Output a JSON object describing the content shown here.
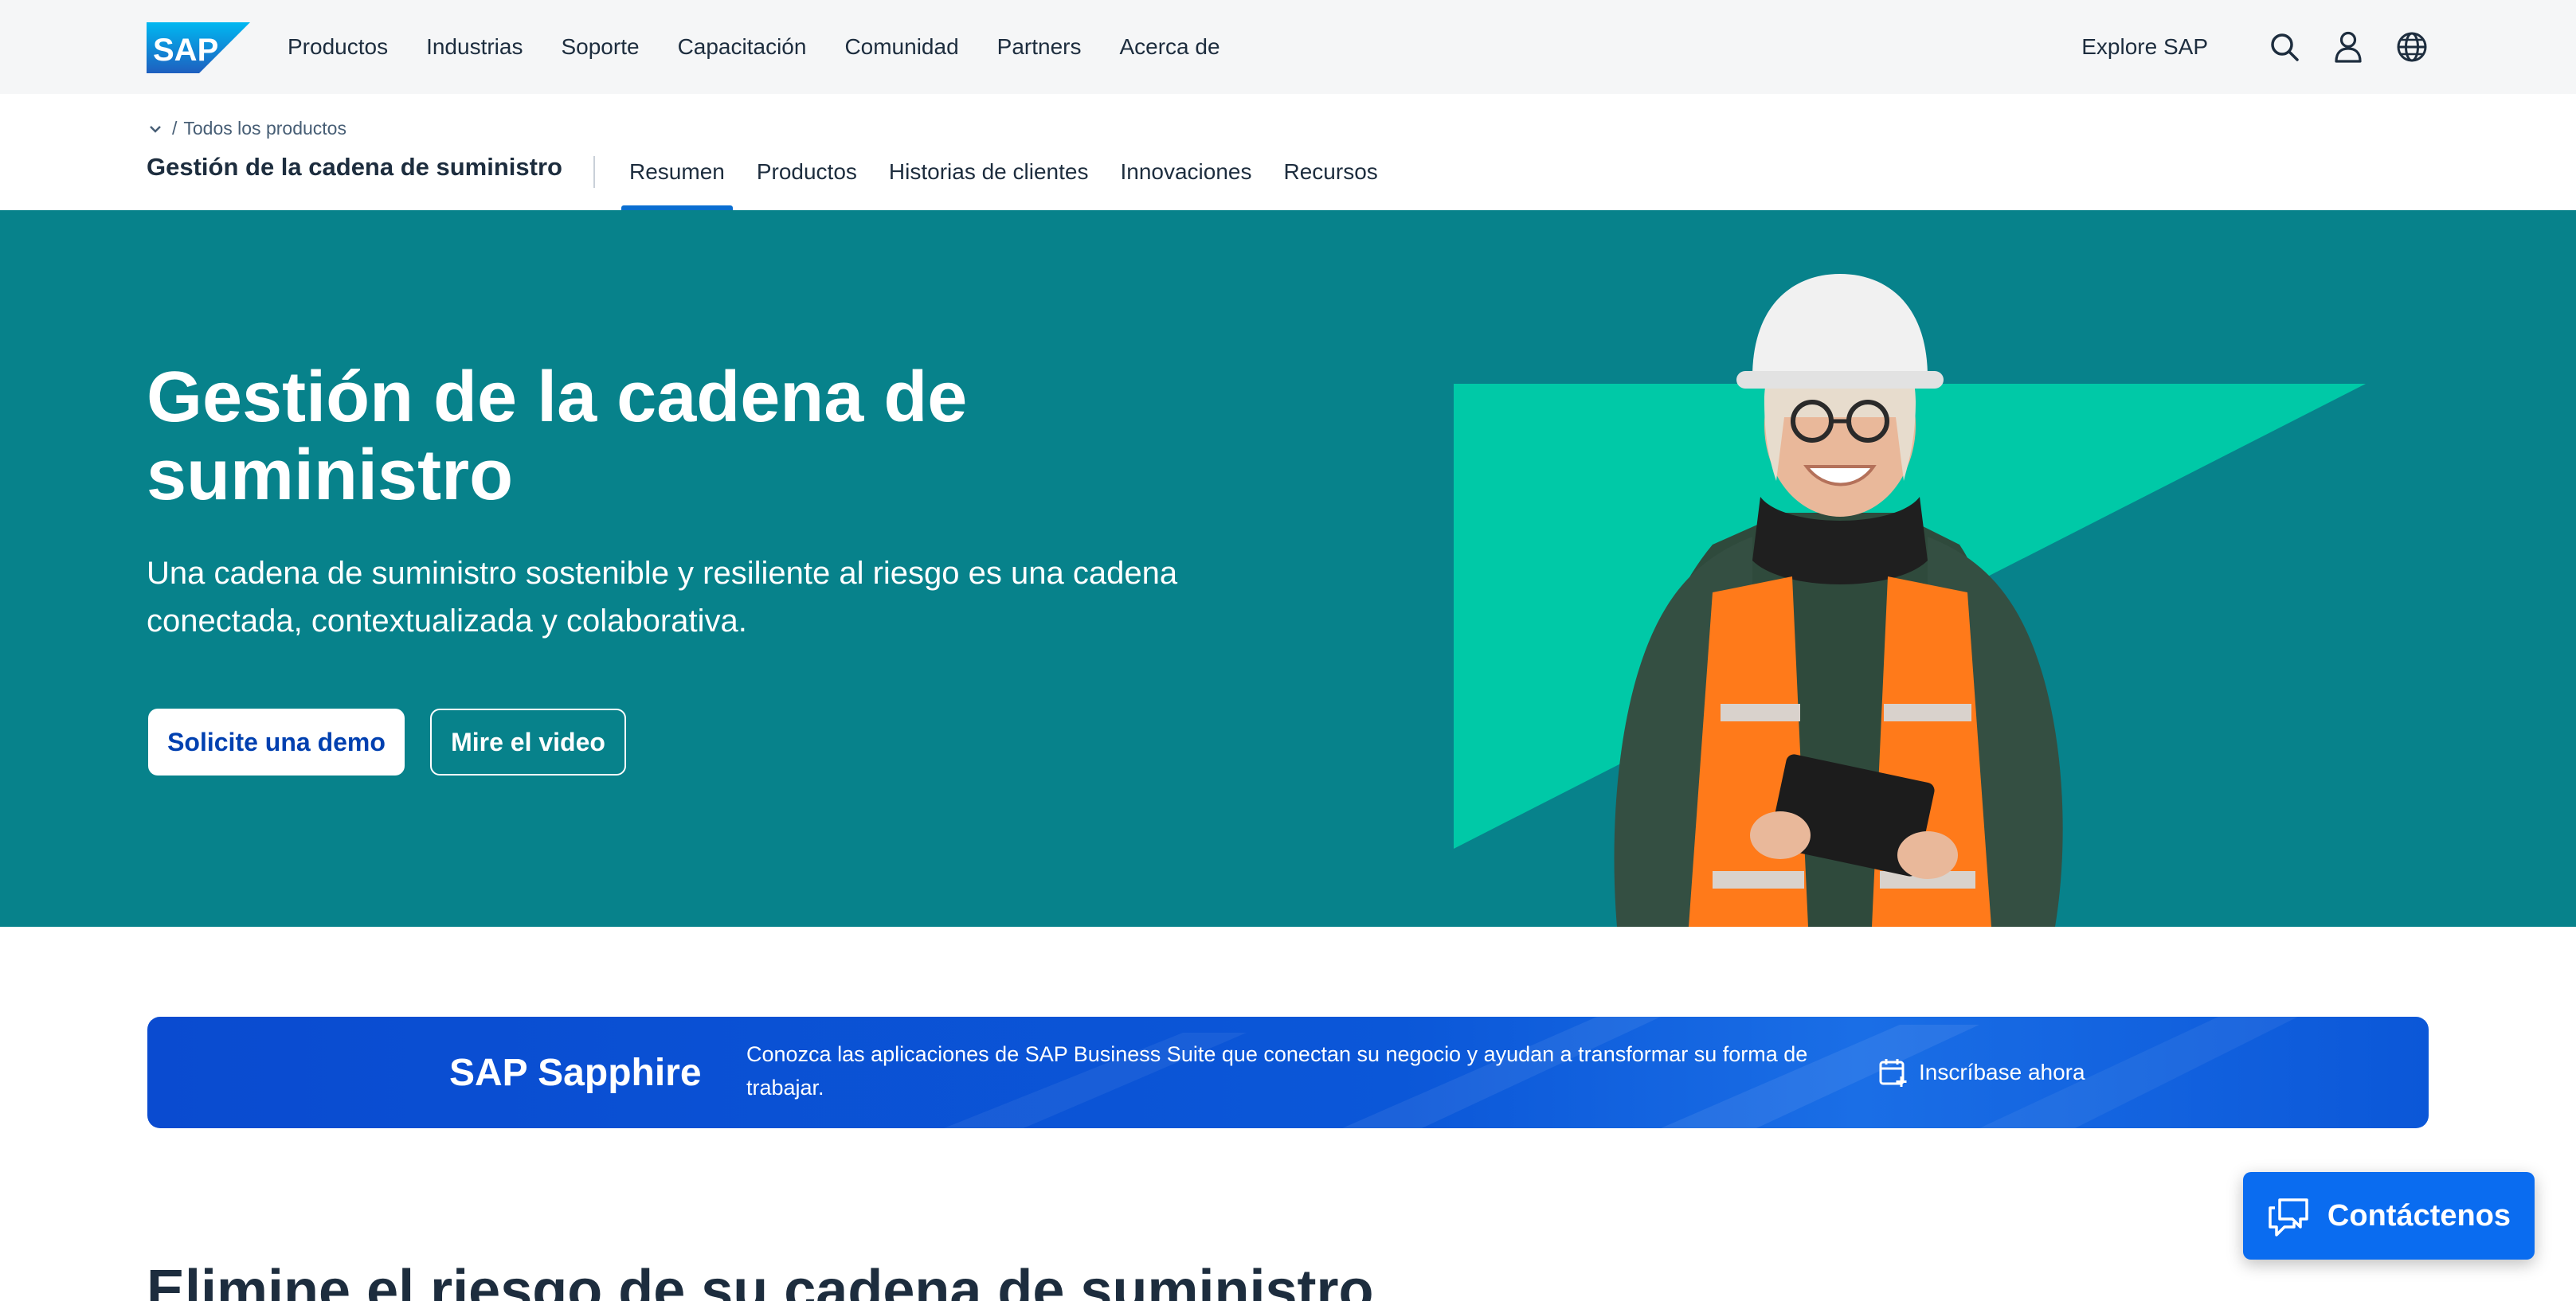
{
  "brand": {
    "logo_text": "SAP"
  },
  "topnav": {
    "links": [
      "Productos",
      "Industrias",
      "Soporte",
      "Capacitación",
      "Comunidad",
      "Partners",
      "Acerca de"
    ],
    "explore": "Explore SAP",
    "icons": [
      "search-icon",
      "user-icon",
      "globe-icon"
    ]
  },
  "subnav": {
    "breadcrumb_sep": "/",
    "breadcrumb": "Todos los productos",
    "title": "Gestión de la cadena de suministro",
    "tabs": [
      {
        "label": "Resumen",
        "active": true
      },
      {
        "label": "Productos",
        "active": false
      },
      {
        "label": "Historias de clientes",
        "active": false
      },
      {
        "label": "Innovaciones",
        "active": false
      },
      {
        "label": "Recursos",
        "active": false
      }
    ]
  },
  "hero": {
    "title": "Gestión de la cadena de suministro",
    "subtitle": "Una cadena de suministro sostenible y resiliente al riesgo es una cadena conectada, contextualizada y colaborativa.",
    "primary_button": "Solicite una demo",
    "secondary_button": "Mire el video",
    "colors": {
      "background": "#07828b",
      "accent_shape": "#00c9a7"
    }
  },
  "banner": {
    "brand": "SAP Sapphire",
    "text": "Conozca las aplicaciones de SAP Business Suite que conectan su negocio y ayudan a transformar su forma de trabajar.",
    "cta": "Inscríbase ahora",
    "cta_icon": "calendar-add-icon"
  },
  "section": {
    "heading": "Elimine el riesgo de su cadena de suministro"
  },
  "contact": {
    "label": "Contáctenos",
    "icon": "chat-icon",
    "color": "#0a6cf0"
  }
}
